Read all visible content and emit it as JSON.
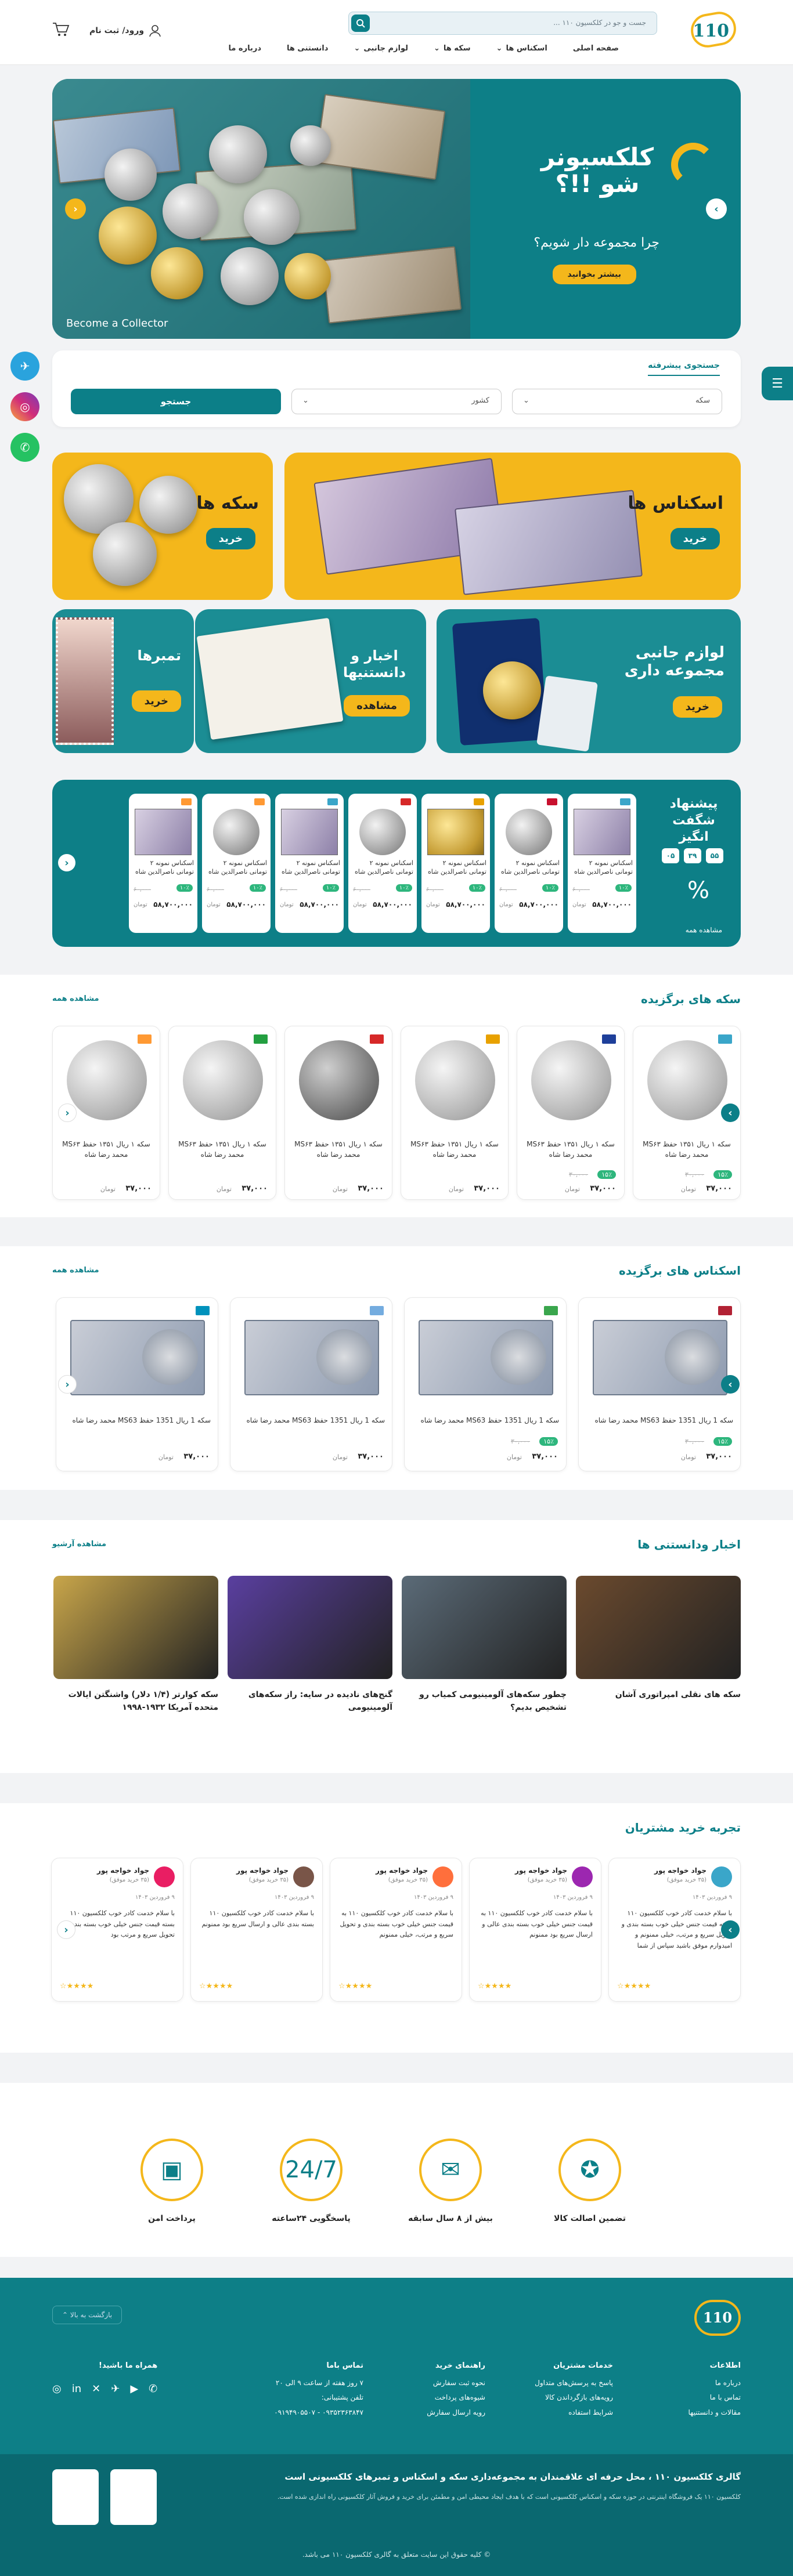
{
  "header": {
    "logo": "110",
    "search_placeholder": "جست و جو در کلکسیون ۱۱۰ ...",
    "nav": [
      "صفحه اصلی",
      "اسکناس ها",
      "سکه ها",
      "لوازم جانبی",
      "دانستنی ها",
      "درباره ما"
    ],
    "auth": "ورود/ ثبت نام"
  },
  "hero": {
    "title_line1": "کلکسیونر",
    "title_line2": "شو !!؟",
    "subtitle": "چرا مجموعه دار شویم؟",
    "button": "بیشتر بخوانید",
    "caption": "Become a Collector"
  },
  "advanced_search": {
    "title": "جستجوی پیشرفته",
    "select1": "سکه",
    "select2": "کشور",
    "button": "جستجو"
  },
  "categories": {
    "banknotes": {
      "title": "اسکناس ها",
      "button": "خرید"
    },
    "coins": {
      "title": "سکه ها",
      "button": "خرید"
    },
    "accessories": {
      "title": "لوازم جانبی مجموعه داری",
      "button": "خرید"
    },
    "news": {
      "title": "اخبار و دانستنیها",
      "button": "مشاهده"
    },
    "stamps": {
      "title": "تمبرها",
      "button": "خرید"
    }
  },
  "offer": {
    "title": "پیشنهاد شگفت انگیز",
    "countdown": [
      "۵۵",
      "۳۹",
      "۰۵"
    ],
    "more": "مشاهده همه",
    "items": [
      {
        "name": "اسکناس نمونه ۲ تومانی ناصرالدین شاه",
        "discount": "۱۰٪",
        "old": "۶۰,۰۰۰",
        "price": "۵۸,۷۰۰,۰۰۰",
        "cur": "تومان",
        "flag": "#3aa6c9"
      },
      {
        "name": "اسکناس نمونه ۲ تومانی ناصرالدین شاه",
        "discount": "۱۰٪",
        "old": "۶۰,۰۰۰",
        "price": "۵۸,۷۰۰,۰۰۰",
        "cur": "تومان",
        "flag": "#c8102e"
      },
      {
        "name": "اسکناس نمونه ۲ تومانی ناصرالدین شاه",
        "discount": "۱۰٪",
        "old": "۶۰,۰۰۰",
        "price": "۵۸,۷۰۰,۰۰۰",
        "cur": "تومان",
        "flag": "#e8a100"
      },
      {
        "name": "اسکناس نمونه ۲ تومانی ناصرالدین شاه",
        "discount": "۱۰٪",
        "old": "۶۰,۰۰۰",
        "price": "۵۸,۷۰۰,۰۰۰",
        "cur": "تومان",
        "flag": "#d62828"
      },
      {
        "name": "اسکناس نمونه ۲ تومانی ناصرالدین شاه",
        "discount": "۱۰٪",
        "old": "۶۰,۰۰۰",
        "price": "۵۸,۷۰۰,۰۰۰",
        "cur": "تومان",
        "flag": "#3aa6c9"
      },
      {
        "name": "اسکناس نمونه ۲ تومانی ناصرالدین شاه",
        "discount": "۱۰٪",
        "old": "۶۰,۰۰۰",
        "price": "۵۸,۷۰۰,۰۰۰",
        "cur": "تومان",
        "flag": "#ff9933"
      },
      {
        "name": "اسکناس نمونه ۲ تومانی ناصرالدین شاه",
        "discount": "۱۰٪",
        "old": "۶۰,۰۰۰",
        "price": "۵۸,۷۰۰,۰۰۰",
        "cur": "تومان",
        "flag": "#ff9933"
      }
    ]
  },
  "featured_coins": {
    "title": "سکه های برگزیده",
    "more": "مشاهده همه",
    "items": [
      {
        "name": "سکه ۱ ریال ۱۳۵۱ حفظ MS۶۳ محمد رضا شاه",
        "discount": "۱۵٪",
        "old": "۳۰,۰۰۰",
        "price": "۳۷,۰۰۰",
        "cur": "تومان",
        "flag": "#3aa6c9"
      },
      {
        "name": "سکه ۱ ریال ۱۳۵۱ حفظ MS۶۳ محمد رضا شاه",
        "discount": "۱۵٪",
        "old": "۳۰,۰۰۰",
        "price": "۳۷,۰۰۰",
        "cur": "تومان",
        "flag": "#1e3f9a"
      },
      {
        "name": "سکه ۱ ریال ۱۳۵۱ حفظ MS۶۳ محمد رضا شاه",
        "discount": "",
        "old": "",
        "price": "۳۷,۰۰۰",
        "cur": "تومان",
        "flag": "#e8a100"
      },
      {
        "name": "سکه ۱ ریال ۱۳۵۱ حفظ MS۶۳ محمد رضا شاه",
        "discount": "",
        "old": "",
        "price": "۳۷,۰۰۰",
        "cur": "تومان",
        "flag": "#d62828"
      },
      {
        "name": "سکه ۱ ریال ۱۳۵۱ حفظ MS۶۳ محمد رضا شاه",
        "discount": "",
        "old": "",
        "price": "۳۷,۰۰۰",
        "cur": "تومان",
        "flag": "#239f40"
      },
      {
        "name": "سکه ۱ ریال ۱۳۵۱ حفظ MS۶۳ محمد رضا شاه",
        "discount": "",
        "old": "",
        "price": "۳۷,۰۰۰",
        "cur": "تومان",
        "flag": "#ff9933"
      }
    ]
  },
  "featured_banknotes": {
    "title": "اسکناس های برگزیده",
    "more": "مشاهده همه",
    "items": [
      {
        "name": "سکه 1 ریال 1351 حفظ MS63 محمد رضا شاه",
        "discount": "۱۵٪",
        "old": "۳۰,۰۰۰",
        "price": "۳۷,۰۰۰",
        "cur": "تومان",
        "flag": "#b22234"
      },
      {
        "name": "سکه 1 ریال 1351 حفظ MS63 محمد رضا شاه",
        "discount": "۱۵٪",
        "old": "۳۰,۰۰۰",
        "price": "۳۷,۰۰۰",
        "cur": "تومان",
        "flag": "#3aa64d"
      },
      {
        "name": "سکه 1 ریال 1351 حفظ MS63 محمد رضا شاه",
        "discount": "",
        "old": "",
        "price": "۳۷,۰۰۰",
        "cur": "تومان",
        "flag": "#74acdf"
      },
      {
        "name": "سکه 1 ریال 1351 حفظ MS63 محمد رضا شاه",
        "discount": "",
        "old": "",
        "price": "۳۷,۰۰۰",
        "cur": "تومان",
        "flag": "#0092bc"
      }
    ]
  },
  "news": {
    "title": "اخبار ودانستنی ها",
    "more": "مشاهده آرشیو",
    "items": [
      {
        "name": "سکه های نقلی امپراتوری آشان",
        "color": "#6b4a2e"
      },
      {
        "name": "چطور سکه‌های آلومینیومی کمیاب رو تشخیص بدیم؟",
        "color": "#5b6b78"
      },
      {
        "name": "گنج‌های نادیده در سایه: راز سکه‌های آلومینیومی",
        "color": "#5a3fa0"
      },
      {
        "name": "سکه کوارتر (۱/۴ دلار) واشنگتن ایالات متحده آمریکا ۱۹۳۲-۱۹۹۸",
        "color": "#c9a64a"
      }
    ]
  },
  "reviews": {
    "title": "تجربه خرید مشتریان",
    "items": [
      {
        "name": "جواد خواجه پور",
        "sub": "(۳۵ خرید موفق)",
        "date": "۹ فروردین ۱۴۰۳",
        "text": "با سلام خدمت کادر خوب کلکسیون ۱۱۰ بسته قیمت جنس خیلی خوب بسته بندی و تحویل سریع و مرتب، خیلی ممنونم و امیدوارم موفق باشید سپاس از شما",
        "stars": "★★★★☆",
        "color": "#3aa6c9"
      },
      {
        "name": "جواد خواجه پور",
        "sub": "(۳۵ خرید موفق)",
        "date": "۹ فروردین ۱۴۰۳",
        "text": "با سلام خدمت کادر خوب کلکسیون ۱۱۰ به قیمت جنس خیلی خوب بسته بندی عالی و ارسال سریع بود ممنونم",
        "stars": "★★★★☆",
        "color": "#9c27b0"
      },
      {
        "name": "جواد خواجه پور",
        "sub": "(۳۵ خرید موفق)",
        "date": "۹ فروردین ۱۴۰۳",
        "text": "با سلام خدمت کادر خوب کلکسیون ۱۱۰ به قیمت جنس خیلی خوب بسته بندی و تحویل سریع و مرتب، خیلی ممنونم",
        "stars": "★★★★☆",
        "color": "#ff6f3c"
      },
      {
        "name": "جواد خواجه پور",
        "sub": "(۳۵ خرید موفق)",
        "date": "۹ فروردین ۱۴۰۳",
        "text": "با سلام خدمت کادر خوب کلکسیون ۱۱۰ بسته بندی عالی و ارسال سریع بود ممنونم",
        "stars": "★★★★☆",
        "color": "#795548"
      },
      {
        "name": "جواد خواجه پور",
        "sub": "(۳۵ خرید موفق)",
        "date": "۹ فروردین ۱۴۰۳",
        "text": "با سلام خدمت کادر خوب کلکسیون ۱۱۰ بسته قیمت جنس خیلی خوب بسته بندی و تحویل سریع و مرتب بود",
        "stars": "★★★★☆",
        "color": "#e91e63"
      }
    ]
  },
  "features": [
    {
      "title": "تضمین اصالت کالا",
      "icon": "✪"
    },
    {
      "title": "بیش از ۸ سال سابقه",
      "icon": "✉"
    },
    {
      "title": "پاسخگویی ۲۴ساعته",
      "icon": "24/7"
    },
    {
      "title": "پرداخت امن",
      "icon": "▣"
    }
  ],
  "footer": {
    "back_top": "بازگشت به بالا",
    "cols": [
      {
        "title": "اطلاعات",
        "items": [
          "درباره ما",
          "تماس با ما",
          "مقالات و دانستنیها"
        ]
      },
      {
        "title": "خدمات مشتریان",
        "items": [
          "پاسخ به پرسش‌های متداول",
          "رویه‌های بازگرداندن کالا",
          "شرایط استفاده"
        ]
      },
      {
        "title": "راهنمای خرید",
        "items": [
          "نحوه ثبت سفارش",
          "شیوه‌های پرداخت",
          "رویه ارسال سفارش"
        ]
      },
      {
        "title": "تماس باما",
        "items": [
          "۷ روز هفته از ساعت ۹ الی ۲۰",
          "تلفن پشتیبانی:",
          "۰۹۳۵۲۳۶۳۸۴۷ - ۰۹۱۹۴۹۰۵۵۰۷"
        ]
      },
      {
        "title": "همراه ما باشید!",
        "items": []
      }
    ],
    "about_title": "گالری کلکسیون ۱۱۰ ، محل حرفه ای علاقمندان به مجموعه‌داری سکه و اسکناس و تمبرهای کلکسیونی است",
    "about_text": "کلکسیون ۱۱۰ یک فروشگاه اینترنتی در حوزه سکه و اسکناس کلکسیونی است که با هدف ایجاد محیطی امن و مطمئن برای خرید و فروش آثار کلکسیونی راه اندازی شده است.",
    "copyright": "© کلیه حقوق این سایت متعلق به گالری کلکسیون ۱۱۰ می باشد."
  },
  "social": [
    "telegram",
    "instagram",
    "whatsapp"
  ]
}
